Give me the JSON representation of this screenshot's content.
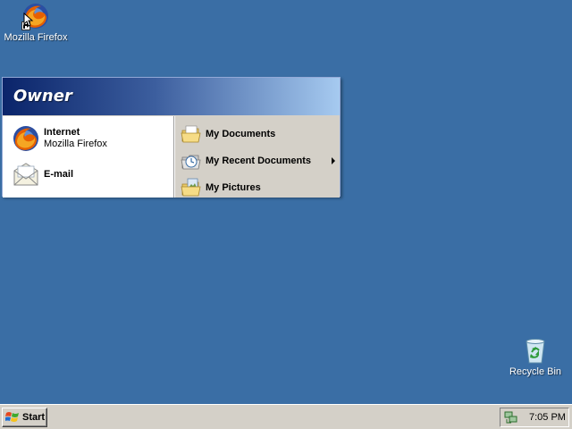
{
  "desktop": {
    "background_color": "#3A6EA5",
    "icons": [
      {
        "label": "Mozilla Firefox",
        "icon": "firefox-icon"
      },
      {
        "label": "Recycle Bin",
        "icon": "recycle-bin-icon"
      }
    ]
  },
  "start_menu": {
    "user_name": "Owner",
    "left_items": [
      {
        "title": "Internet",
        "subtitle": "Mozilla Firefox",
        "icon": "firefox-icon"
      },
      {
        "title": "E-mail",
        "subtitle": "",
        "icon": "envelope-icon"
      }
    ],
    "right_items": [
      {
        "label": "My Documents",
        "icon": "folder-documents-icon"
      },
      {
        "label": "My Recent Documents",
        "icon": "recent-documents-icon",
        "has_submenu": true
      },
      {
        "label": "My Pictures",
        "icon": "folder-pictures-icon"
      }
    ]
  },
  "taskbar": {
    "start_label": "Start",
    "clock": "7:05 PM",
    "tray_icons": [
      "network-icon"
    ]
  }
}
